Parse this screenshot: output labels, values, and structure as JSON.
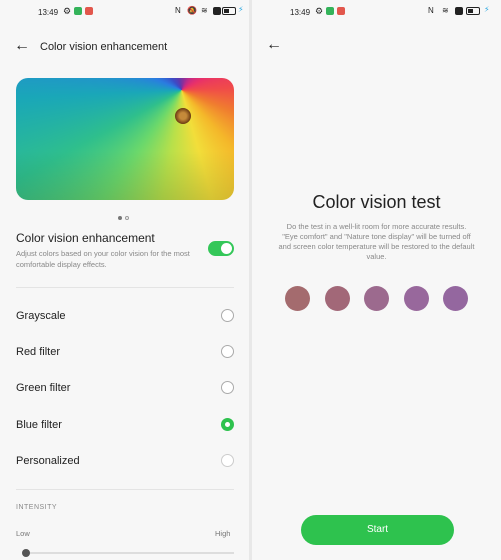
{
  "status_bar": {
    "time": "13:49",
    "left_icons": [
      "gear-icon",
      "green-app-icon",
      "red-app-icon"
    ],
    "right_icons": [
      "nfc-icon",
      "mute-icon",
      "wifi-icon",
      "close-box-icon",
      "battery-icon",
      "charging-bolt-icon"
    ]
  },
  "left_screen": {
    "title": "Color vision enhancement",
    "carousel": {
      "pages": 2,
      "active": 1
    },
    "toggle": {
      "label": "Color vision enhancement",
      "description": "Adjust colors based on your color vision for the most comfortable display effects.",
      "on": true
    },
    "options": [
      {
        "label": "Grayscale",
        "selected": false
      },
      {
        "label": "Red filter",
        "selected": false
      },
      {
        "label": "Green filter",
        "selected": false
      },
      {
        "label": "Blue filter",
        "selected": true
      },
      {
        "label": "Personalized",
        "selected": false
      }
    ],
    "intensity": {
      "section_label": "INTENSITY",
      "low_label": "Low",
      "high_label": "High",
      "value": 0
    }
  },
  "right_screen": {
    "test_title": "Color vision test",
    "test_description": "Do the test in a well-lit room for more accurate results.\n\"Eye comfort\" and \"Nature tone display\" will be turned off and screen color temperature will be restored to the default value.",
    "swatches": [
      "#a46b6e",
      "#a26878",
      "#9c6a8e",
      "#98689c",
      "#94679f"
    ],
    "start_label": "Start"
  },
  "colors": {
    "accent": "#2ec24e",
    "switch_on": "#34c759"
  }
}
